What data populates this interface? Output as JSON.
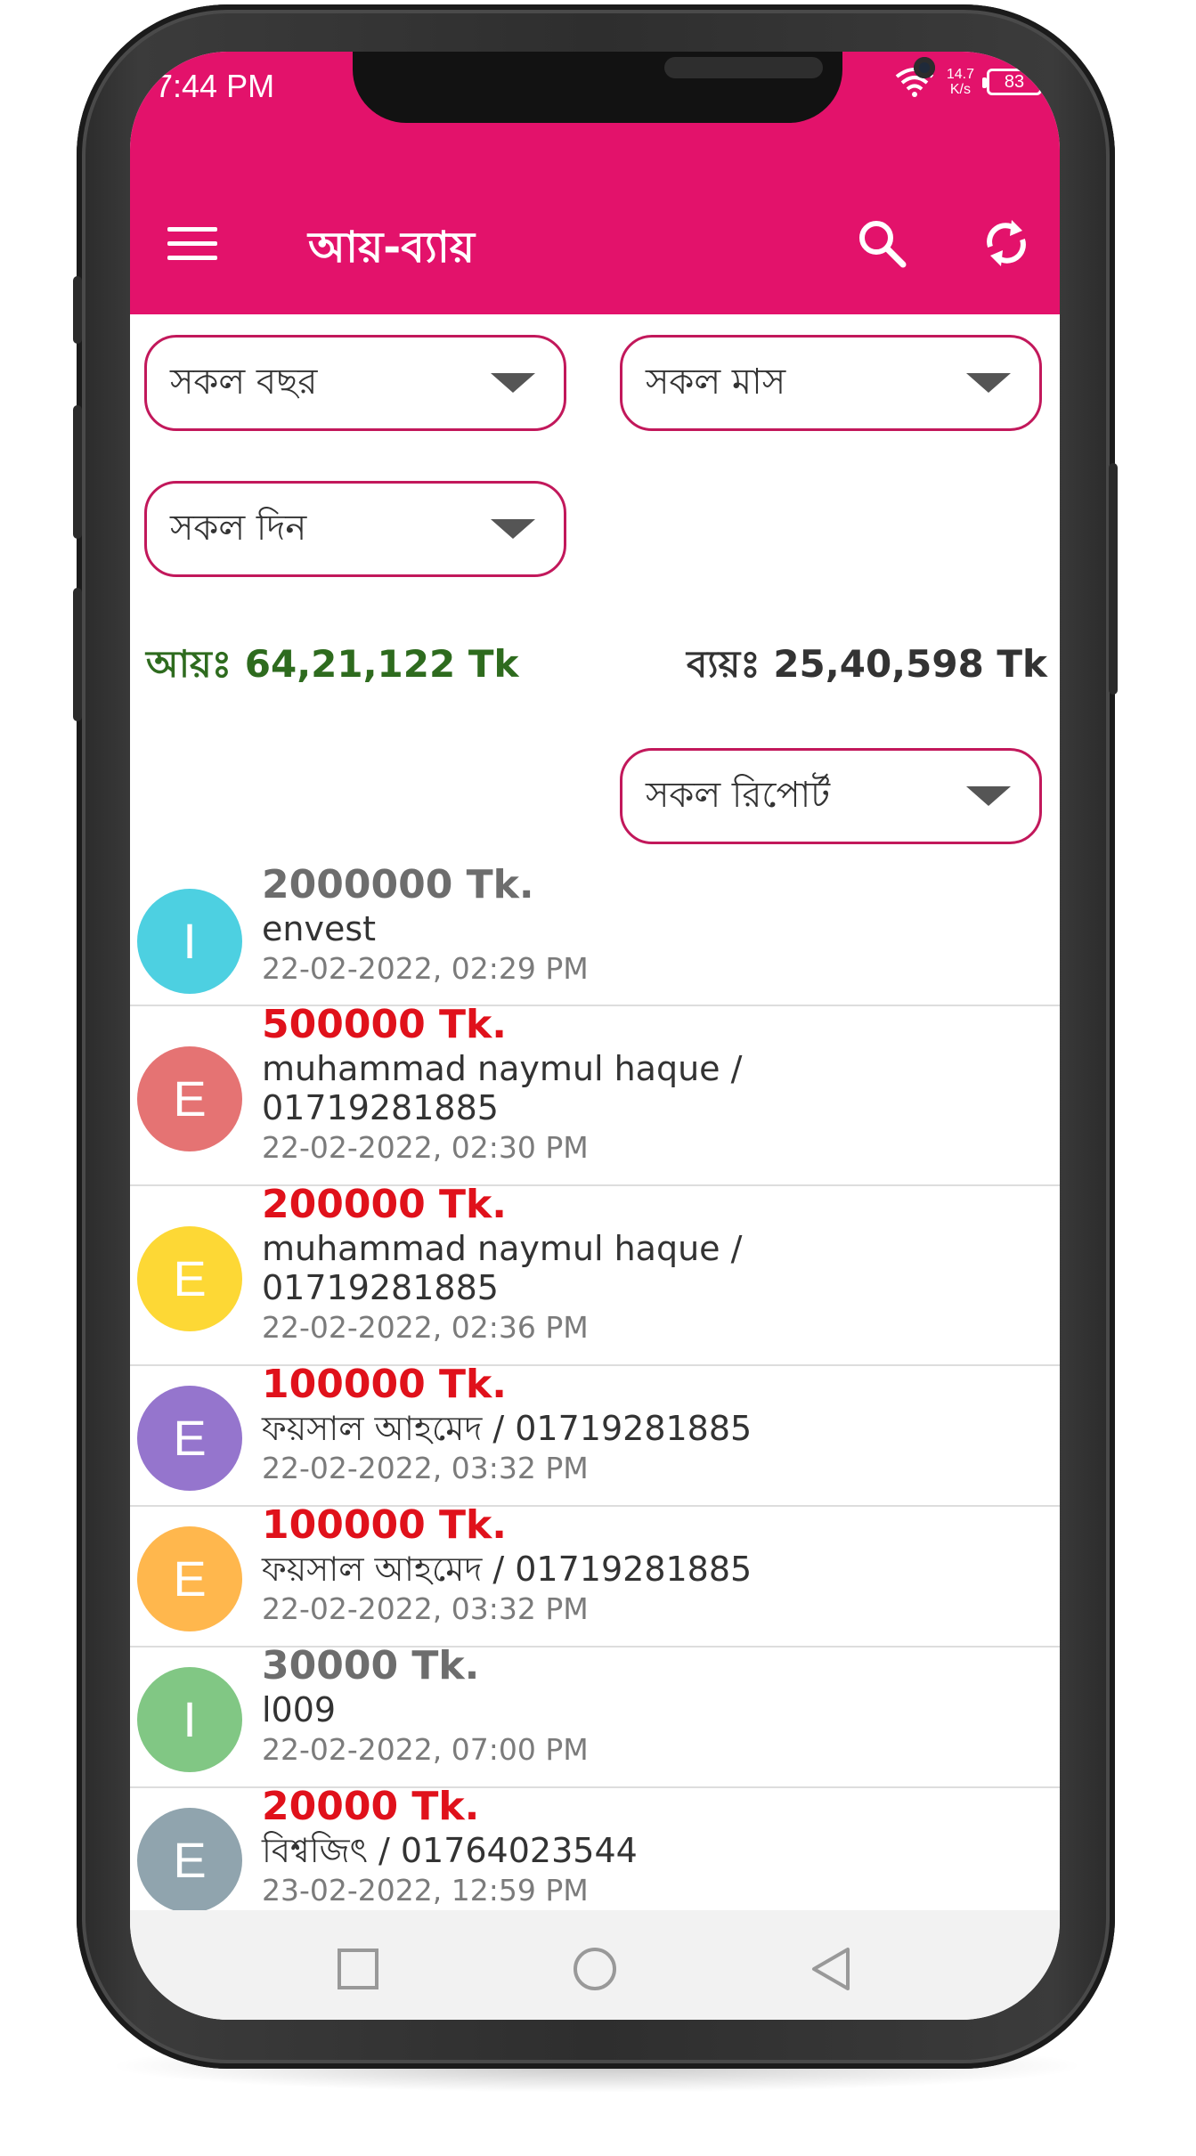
{
  "status_bar": {
    "time": "7:44 PM",
    "net_speed_value": "14.7",
    "net_speed_unit": "K/s",
    "battery": "83",
    "icons": [
      "wifi-icon",
      "battery-icon"
    ]
  },
  "toolbar": {
    "title": "আয়-ব্যায়",
    "menu_icon": "hamburger-menu-icon",
    "search_icon": "search-icon",
    "refresh_icon": "refresh-icon",
    "background_color": "#e3126b"
  },
  "filters": {
    "year": "সকল বছর",
    "month": "সকল মাস",
    "day": "সকল দিন",
    "report": "সকল রিপোর্ট"
  },
  "totals": {
    "income_label": "আয়ঃ",
    "income_value": "64,21,122 Tk",
    "expense_label": "ব্যয়ঃ",
    "expense_value": "25,40,598 Tk"
  },
  "transactions": [
    {
      "letter": "I",
      "color": "#4dd0e1",
      "type": "income",
      "amount": "2000000 Tk.",
      "name": "envest",
      "date": "22-02-2022, 02:29 PM"
    },
    {
      "letter": "E",
      "color": "#e57373",
      "type": "expense",
      "amount": "500000 Tk.",
      "name": "muhammad naymul haque /",
      "name2": "01719281885",
      "date": "22-02-2022, 02:30 PM"
    },
    {
      "letter": "E",
      "color": "#fdd835",
      "type": "expense",
      "amount": "200000 Tk.",
      "name": "muhammad naymul haque /",
      "name2": "01719281885",
      "date": "22-02-2022, 02:36 PM"
    },
    {
      "letter": "E",
      "color": "#9575cd",
      "type": "expense",
      "amount": "100000 Tk.",
      "name": "ফয়সাল আহমেদ / 01719281885",
      "date": "22-02-2022, 03:32 PM"
    },
    {
      "letter": "E",
      "color": "#ffb74d",
      "type": "expense",
      "amount": "100000 Tk.",
      "name": "ফয়সাল আহমেদ / 01719281885",
      "date": "22-02-2022, 03:32 PM"
    },
    {
      "letter": "I",
      "color": "#81c784",
      "type": "income",
      "amount": "30000 Tk.",
      "name": "l009",
      "date": "22-02-2022, 07:00 PM"
    },
    {
      "letter": "E",
      "color": "#90a4ae",
      "type": "expense",
      "amount": "20000 Tk.",
      "name": "বিশ্বজিৎ / 01764023544",
      "date": "23-02-2022, 12:59 PM"
    }
  ],
  "nav_bar": {
    "icons": [
      "recent-apps-icon",
      "home-icon",
      "back-icon"
    ]
  }
}
